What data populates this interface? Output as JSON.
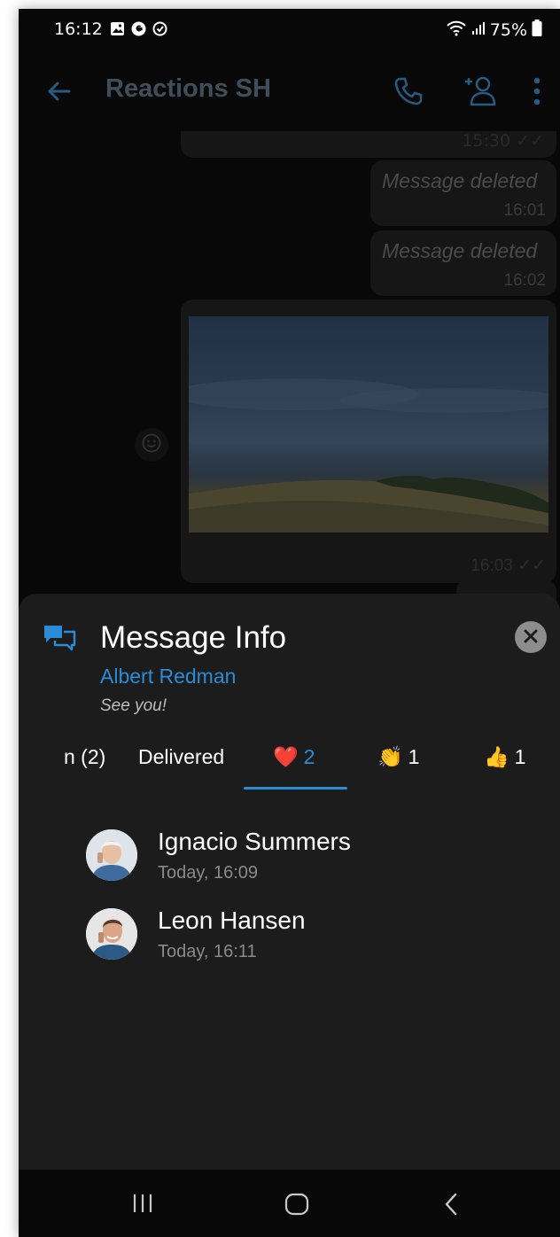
{
  "status_bar": {
    "time": "16:12",
    "battery": "75%"
  },
  "app_bar": {
    "title": "Reactions SH"
  },
  "chat": {
    "messages": [
      {
        "time": "15:30"
      },
      {
        "text": "Message deleted",
        "time": "16:01"
      },
      {
        "text": "Message deleted",
        "time": "16:02"
      },
      {
        "time": "16:03"
      }
    ]
  },
  "sheet": {
    "title": "Message Info",
    "sender": "Albert Redman",
    "message_preview": "See you!",
    "tabs": [
      {
        "label": "n (2)"
      },
      {
        "label": "Delivered"
      },
      {
        "emoji": "❤️",
        "count": "2",
        "active": true
      },
      {
        "emoji": "👏",
        "count": "1"
      },
      {
        "emoji": "👍",
        "count": "1"
      }
    ],
    "users": [
      {
        "name": "Ignacio Summers",
        "time": "Today, 16:09"
      },
      {
        "name": "Leon Hansen",
        "time": "Today, 16:11"
      }
    ]
  },
  "colors": {
    "accent": "#2a8bd6",
    "sheet_bg": "#1c1c1c",
    "screen_bg": "#080808"
  }
}
